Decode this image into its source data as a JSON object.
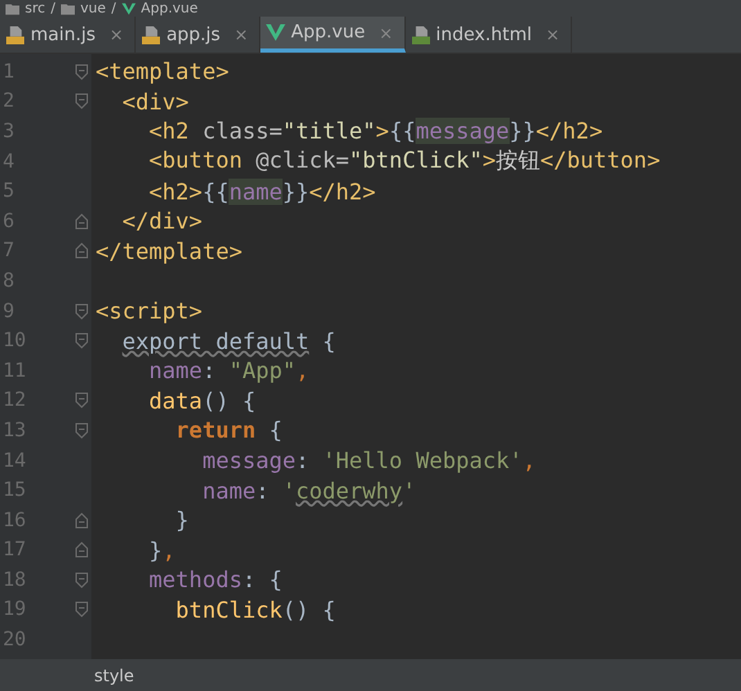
{
  "breadcrumb": [
    {
      "label": "src",
      "kind": "folder",
      "separator": "/"
    },
    {
      "label": "vue",
      "kind": "folder",
      "separator": "/"
    },
    {
      "label": "App.vue",
      "kind": "vue"
    }
  ],
  "tabs": [
    {
      "label": "main.js",
      "kind": "js",
      "close": "×",
      "selected": false
    },
    {
      "label": "app.js",
      "kind": "js",
      "close": "×",
      "selected": false
    },
    {
      "label": "App.vue",
      "kind": "vue",
      "close": "×",
      "selected": true
    },
    {
      "label": "index.html",
      "kind": "html",
      "close": "×",
      "selected": false
    }
  ],
  "lines": [
    {
      "number": "1",
      "fold_start": true,
      "tokens": [
        {
          "kind": "tag",
          "text": "<template>"
        }
      ]
    },
    {
      "number": "2",
      "fold_start": true,
      "tokens": [
        {
          "kind": "tag",
          "text": "  <div>"
        }
      ]
    },
    {
      "number": "3",
      "tokens": [
        {
          "kind": "tag",
          "text": "    <h2 "
        },
        {
          "kind": "attr",
          "text": "class="
        },
        {
          "kind": "attrval",
          "text": "\"title\""
        },
        {
          "kind": "tag",
          "text": ">"
        },
        {
          "kind": "plain",
          "text": "{{"
        },
        {
          "kind": "prop",
          "text": "message",
          "highlighted": true
        },
        {
          "kind": "plain",
          "text": "}}"
        },
        {
          "kind": "tag",
          "text": "</h2>"
        }
      ]
    },
    {
      "number": "4",
      "tokens": [
        {
          "kind": "tag",
          "text": "    <button "
        },
        {
          "kind": "attr",
          "text": "@click="
        },
        {
          "kind": "attrval",
          "text": "\"btnClick\""
        },
        {
          "kind": "tag",
          "text": ">"
        },
        {
          "kind": "cjk",
          "text": "按钮"
        },
        {
          "kind": "tag",
          "text": "</button>"
        }
      ]
    },
    {
      "number": "5",
      "tokens": [
        {
          "kind": "tag",
          "text": "    <h2>"
        },
        {
          "kind": "plain",
          "text": "{{"
        },
        {
          "kind": "prop",
          "text": "name",
          "highlighted": true
        },
        {
          "kind": "plain",
          "text": "}}"
        },
        {
          "kind": "tag",
          "text": "</h2>"
        }
      ]
    },
    {
      "number": "6",
      "fold_end": true,
      "tokens": [
        {
          "kind": "tag",
          "text": "  </div>"
        }
      ]
    },
    {
      "number": "7",
      "fold_end": true,
      "tokens": [
        {
          "kind": "tag",
          "text": "</template>"
        }
      ]
    },
    {
      "number": "8"
    },
    {
      "number": "9",
      "fold_start": true,
      "tokens": [
        {
          "kind": "tag",
          "text": "<script>"
        }
      ]
    },
    {
      "number": "10",
      "fold_start": true,
      "tokens": [
        {
          "kind": "plain",
          "text": "  export default",
          "underlined": true
        },
        {
          "kind": "plain",
          "text": " {"
        }
      ]
    },
    {
      "number": "11",
      "tokens": [
        {
          "kind": "prop",
          "text": "    name"
        },
        {
          "kind": "plain",
          "text": ": "
        },
        {
          "kind": "string",
          "text": "\"App\""
        },
        {
          "kind": "keyword",
          "text": ","
        }
      ]
    },
    {
      "number": "12",
      "fold_start": true,
      "tokens": [
        {
          "kind": "func",
          "text": "    data"
        },
        {
          "kind": "plain",
          "text": "() {"
        }
      ]
    },
    {
      "number": "13",
      "fold_start": true,
      "tokens": [
        {
          "kind": "keyword",
          "text": "      return"
        },
        {
          "kind": "plain",
          "text": " {"
        }
      ]
    },
    {
      "number": "14",
      "tokens": [
        {
          "kind": "prop",
          "text": "        message"
        },
        {
          "kind": "plain",
          "text": ": "
        },
        {
          "kind": "string",
          "text": "'Hello Webpack'"
        },
        {
          "kind": "keyword",
          "text": ","
        }
      ]
    },
    {
      "number": "15",
      "tokens": [
        {
          "kind": "prop",
          "text": "        name"
        },
        {
          "kind": "plain",
          "text": ": "
        },
        {
          "kind": "string",
          "text": "'"
        },
        {
          "kind": "string",
          "text": "coderwhy",
          "underlined": true
        },
        {
          "kind": "string",
          "text": "'"
        }
      ]
    },
    {
      "number": "16",
      "fold_end": true,
      "tokens": [
        {
          "kind": "plain",
          "text": "      }"
        }
      ]
    },
    {
      "number": "17",
      "fold_end": true,
      "tokens": [
        {
          "kind": "plain",
          "text": "    }"
        },
        {
          "kind": "keyword",
          "text": ","
        }
      ]
    },
    {
      "number": "18",
      "fold_start": true,
      "tokens": [
        {
          "kind": "prop",
          "text": "    methods"
        },
        {
          "kind": "plain",
          "text": ": {"
        }
      ]
    },
    {
      "number": "19",
      "fold_start": true,
      "tokens": [
        {
          "kind": "func",
          "text": "      btnClick"
        },
        {
          "kind": "plain",
          "text": "() {"
        }
      ]
    },
    {
      "number": "20"
    }
  ],
  "status_bar": {
    "text": "style"
  }
}
